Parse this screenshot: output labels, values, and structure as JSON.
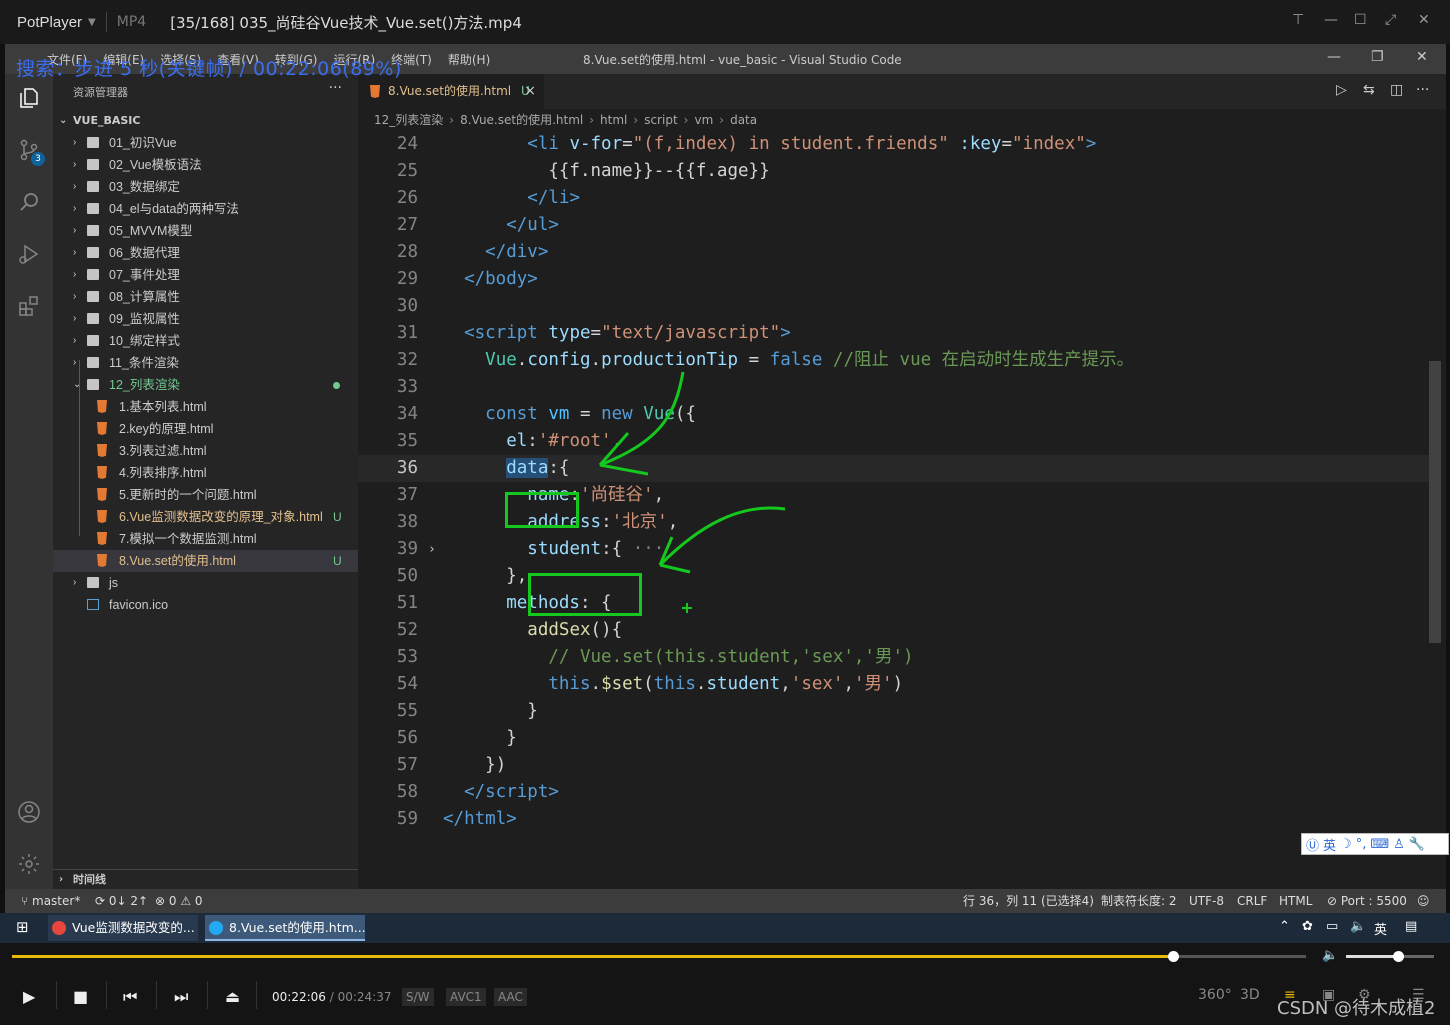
{
  "player": {
    "brand": "PotPlayer",
    "format": "MP4",
    "file_title": "[35/168] 035_尚硅谷Vue技术_Vue.set()方法.mp4",
    "osd": "搜索：步进 5 秒(关键帧) / 00:22:06(89%)",
    "time_current": "00:22:06",
    "time_total": "00:24:37",
    "chip_sw": "S/W",
    "chip_codec": "AVC1",
    "chip_audio": "AAC",
    "right_360": "360°",
    "right_3d": "3D",
    "progress_fraction": 0.898,
    "volume_fraction": 0.59,
    "watermark": "CSDN @待木成植2"
  },
  "vscode": {
    "menu": [
      "文件(F)",
      "编辑(E)",
      "选择(S)",
      "查看(V)",
      "转到(G)",
      "运行(R)",
      "终端(T)",
      "帮助(H)"
    ],
    "window_title": "8.Vue.set的使用.html - vue_basic - Visual Studio Code",
    "scm_badge": "3",
    "explorer_header": "资源管理器",
    "explorer_dots": "···",
    "section_title": "VUE_BASIC",
    "timeline": "时间线",
    "tree": [
      {
        "type": "folder",
        "label": "01_初识Vue"
      },
      {
        "type": "folder",
        "label": "02_Vue模板语法"
      },
      {
        "type": "folder",
        "label": "03_数据绑定"
      },
      {
        "type": "folder",
        "label": "04_el与data的两种写法"
      },
      {
        "type": "folder",
        "label": "05_MVVM模型"
      },
      {
        "type": "folder",
        "label": "06_数据代理"
      },
      {
        "type": "folder",
        "label": "07_事件处理"
      },
      {
        "type": "folder",
        "label": "08_计算属性"
      },
      {
        "type": "folder",
        "label": "09_监视属性"
      },
      {
        "type": "folder",
        "label": "10_绑定样式"
      },
      {
        "type": "folder",
        "label": "11_条件渲染"
      },
      {
        "type": "folder-open",
        "label": "12_列表渲染",
        "modified_dot": true
      },
      {
        "type": "file",
        "label": "1.基本列表.html"
      },
      {
        "type": "file",
        "label": "2.key的原理.html"
      },
      {
        "type": "file",
        "label": "3.列表过滤.html"
      },
      {
        "type": "file",
        "label": "4.列表排序.html"
      },
      {
        "type": "file",
        "label": "5.更新时的一个问题.html"
      },
      {
        "type": "file",
        "label": "6.Vue监测数据改变的原理_对象.html",
        "status": "U"
      },
      {
        "type": "file",
        "label": "7.模拟一个数据监测.html"
      },
      {
        "type": "file",
        "label": "8.Vue.set的使用.html",
        "status": "U",
        "selected": true
      },
      {
        "type": "folder",
        "label": "js",
        "root": true
      },
      {
        "type": "ico",
        "label": "favicon.ico",
        "root": true
      }
    ],
    "tab": {
      "label": "8.Vue.set的使用.html",
      "status": "U",
      "close": "×"
    },
    "breadcrumbs": [
      "12_列表渲染",
      "8.Vue.set的使用.html",
      "html",
      "script",
      "vm",
      "data"
    ],
    "code_lines": [
      {
        "n": "24",
        "html": "        <span class='tag'>&lt;li</span> <span class='attr'>v-for</span><span class='plain'>=</span><span class='str'>\"(f,index) in student.friends\"</span> <span class='attr'>:key</span><span class='plain'>=</span><span class='str'>\"index\"</span><span class='tag'>&gt;</span>"
      },
      {
        "n": "25",
        "html": "          <span class='plain'>{{f.name}}--{{f.age}}</span>"
      },
      {
        "n": "26",
        "html": "        <span class='tag'>&lt;/li&gt;</span>"
      },
      {
        "n": "27",
        "html": "      <span class='tag'>&lt;/ul&gt;</span>"
      },
      {
        "n": "28",
        "html": "    <span class='tag'>&lt;/div&gt;</span>"
      },
      {
        "n": "29",
        "html": "  <span class='tag'>&lt;/body&gt;</span>"
      },
      {
        "n": "30",
        "html": ""
      },
      {
        "n": "31",
        "html": "  <span class='tag'>&lt;script</span> <span class='attr'>type</span><span class='plain'>=</span><span class='str'>\"text/javascript\"</span><span class='tag'>&gt;</span>"
      },
      {
        "n": "32",
        "html": "    <span class='cls'>Vue</span><span class='plain'>.</span><span class='prop'>config</span><span class='plain'>.</span><span class='prop'>productionTip</span> <span class='plain'>=</span> <span class='kw'>false</span> <span class='cmt'>//阻止 vue 在启动时生成生产提示。</span>"
      },
      {
        "n": "33",
        "html": ""
      },
      {
        "n": "34",
        "html": "    <span class='kw'>const</span> <span class='var'>vm</span> <span class='plain'>=</span> <span class='kw'>new</span> <span class='cls'>Vue</span><span class='plain'>({</span>"
      },
      {
        "n": "35",
        "html": "      <span class='prop'>el</span><span class='plain'>:</span><span class='str'>'#root'</span><span class='plain'>,</span>"
      },
      {
        "n": "36",
        "html": "      <span class='prop hilite'>data</span><span class='plain'>:{</span>",
        "current": true
      },
      {
        "n": "37",
        "html": "        <span class='prop'>name</span><span class='plain'>:</span><span class='str'>'尚硅谷'</span><span class='plain'>,</span>"
      },
      {
        "n": "38",
        "html": "        <span class='prop'>address</span><span class='plain'>:</span><span class='str'>'北京'</span><span class='plain'>,</span>"
      },
      {
        "n": "39",
        "html": "        <span class='prop'>student</span><span class='plain'>:{</span> <span class='punc'>···</span>",
        "folded": true
      },
      {
        "n": "50",
        "html": "      <span class='plain'>},</span>"
      },
      {
        "n": "51",
        "html": "      <span class='prop'>methods</span><span class='plain'>: {</span>"
      },
      {
        "n": "52",
        "html": "        <span class='fn'>addSex</span><span class='plain'>(){</span>"
      },
      {
        "n": "53",
        "html": "          <span class='cmt'>// Vue.set(this.student,'sex','男')</span>"
      },
      {
        "n": "54",
        "html": "          <span class='kw'>this</span><span class='plain'>.</span><span class='fn'>$set</span><span class='plain'>(</span><span class='kw'>this</span><span class='plain'>.</span><span class='prop'>student</span><span class='plain'>,</span><span class='str'>'sex'</span><span class='plain'>,</span><span class='str'>'男'</span><span class='plain'>)</span>"
      },
      {
        "n": "55",
        "html": "        <span class='plain'>}</span>"
      },
      {
        "n": "56",
        "html": "      <span class='plain'>}</span>"
      },
      {
        "n": "57",
        "html": "    <span class='plain'>})</span>"
      },
      {
        "n": "58",
        "html": "  <span class='tag'>&lt;/script&gt;</span>"
      },
      {
        "n": "59",
        "html": "<span class='tag'>&lt;/html&gt;</span>"
      }
    ],
    "ime_text": "英",
    "status": {
      "branch": "master*",
      "sync": "0↓ 2↑",
      "problems": "⊗ 0 ⚠ 0",
      "position": "行 36，列 11 (已选择4)",
      "tab_size": "制表符长度: 2",
      "encoding": "UTF-8",
      "eol": "CRLF",
      "language": "HTML",
      "port": "Port : 5500"
    }
  },
  "taskbar": {
    "chrome_task": "Vue监测数据改变的...",
    "vscode_task": "8.Vue.set的使用.htm...",
    "ime": "英"
  },
  "colors": {
    "annotation_green": "#14c81e",
    "seek_yellow": "#e8b80c",
    "osd_blue": "#3a6df0"
  }
}
